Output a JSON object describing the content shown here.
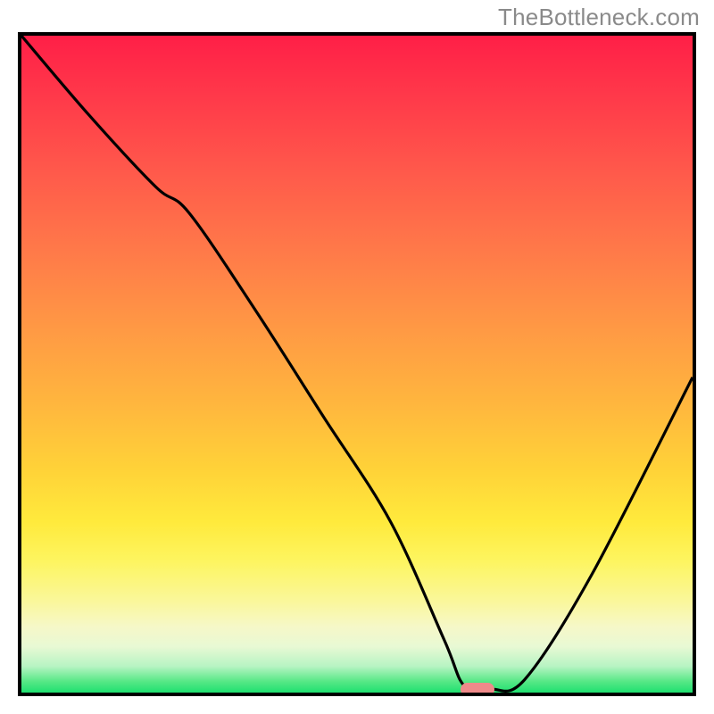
{
  "watermark": "TheBottleneck.com",
  "chart_data": {
    "type": "line",
    "title": "",
    "xlabel": "",
    "ylabel": "",
    "xlim": [
      0,
      100
    ],
    "ylim": [
      0,
      100
    ],
    "grid": false,
    "series": [
      {
        "name": "curve",
        "x": [
          0,
          10,
          20,
          25,
          35,
          45,
          55,
          63,
          66,
          70,
          75,
          85,
          100
        ],
        "y": [
          100,
          88,
          77,
          73,
          58,
          42,
          26,
          8,
          1,
          0.5,
          2,
          18,
          48
        ]
      }
    ],
    "marker": {
      "x": 68,
      "y": 0.5
    },
    "annotations": []
  },
  "colors": {
    "curve": "#000000",
    "marker": "#ef8a8a",
    "frame": "#000000",
    "watermark": "#8a8a8a"
  }
}
